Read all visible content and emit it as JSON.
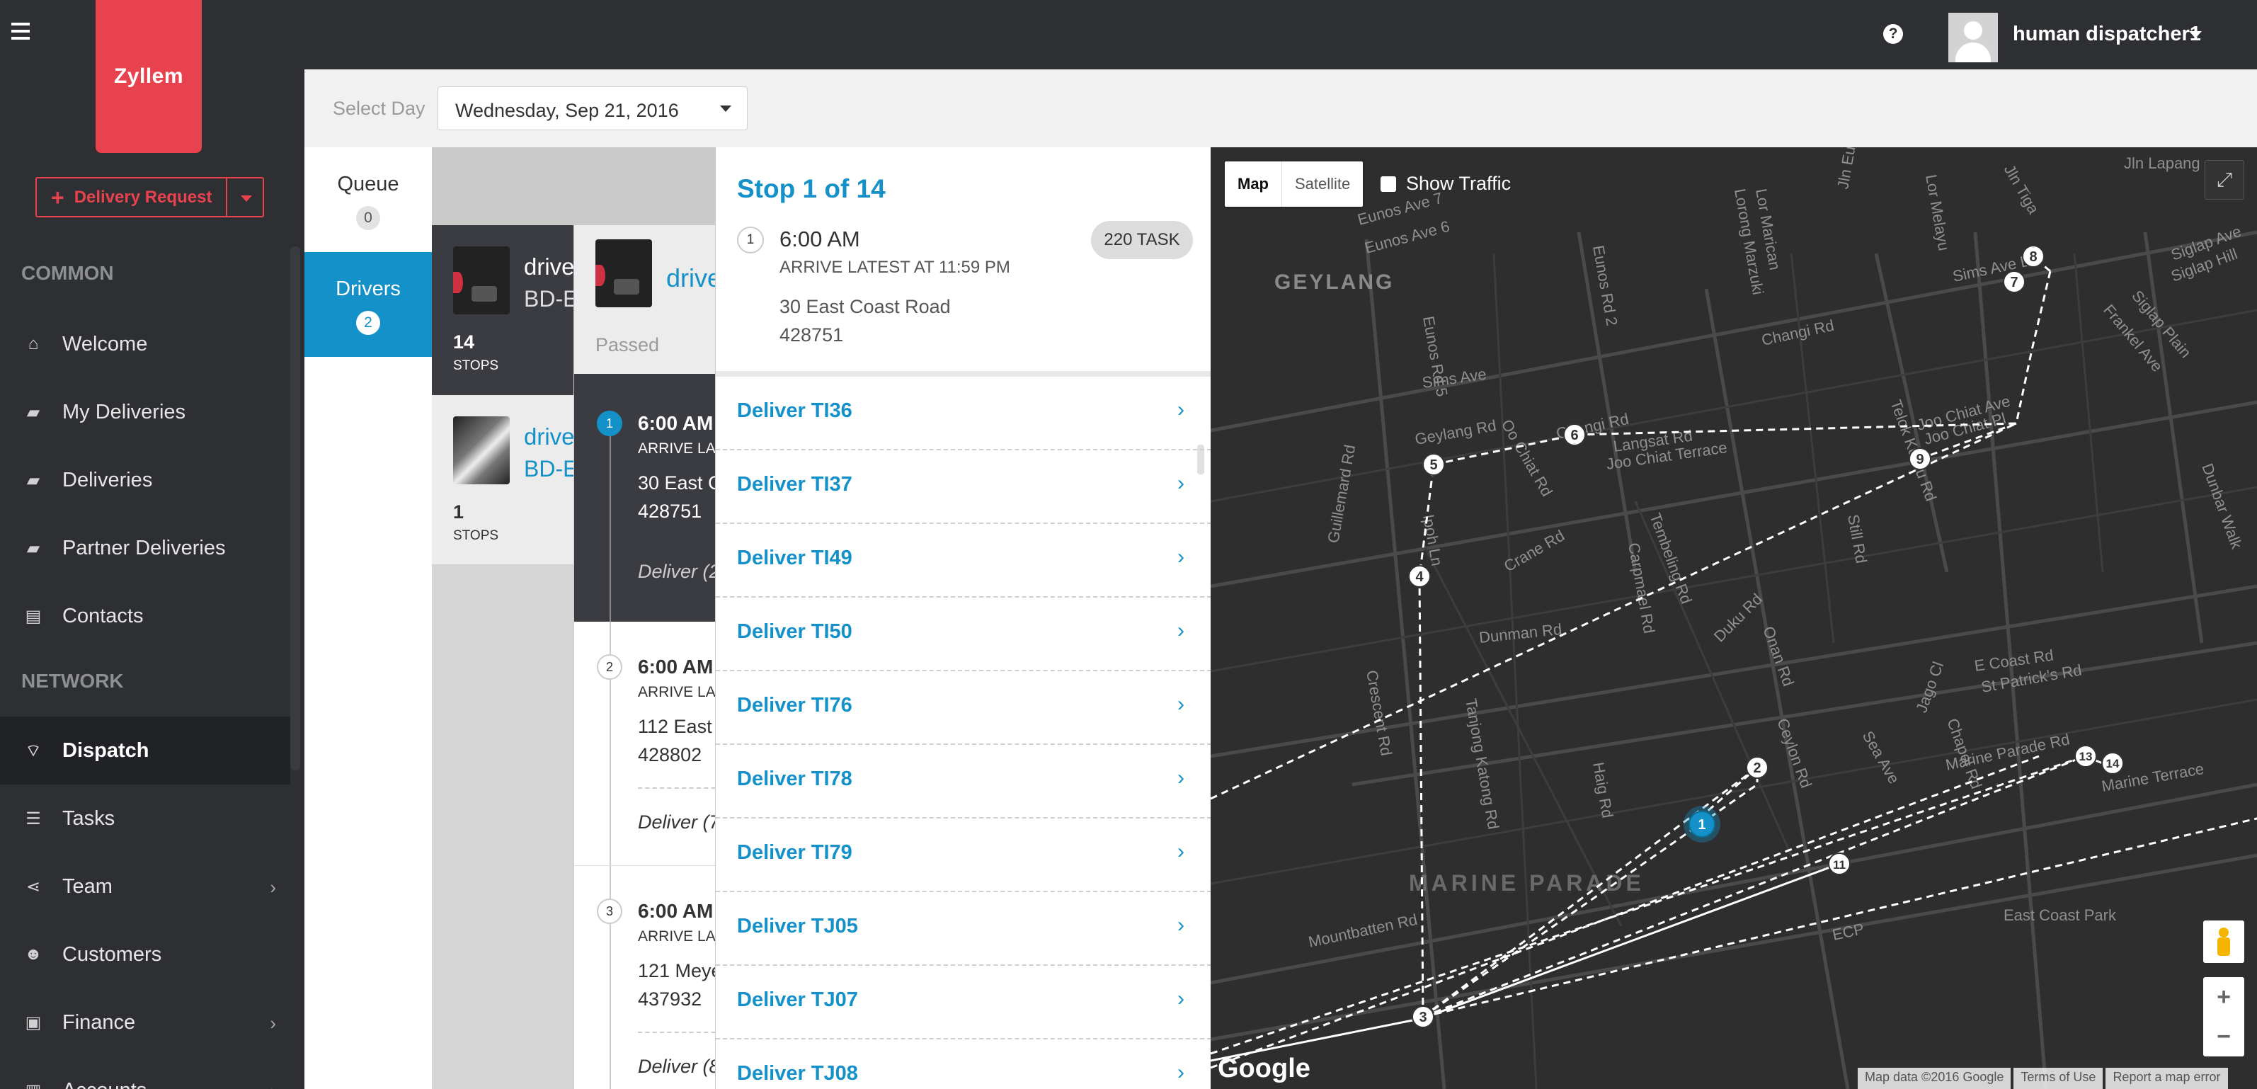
{
  "app": {
    "brand": "Zyllem"
  },
  "header": {
    "user_name": "human dispatcher1",
    "help_icon": "question-circle-icon",
    "menu_icon": "hamburger-icon"
  },
  "sidebar": {
    "delivery_request_label": "Delivery Request",
    "sections": {
      "common": "COMMON",
      "network": "NETWORK"
    },
    "items": [
      {
        "label": "Welcome",
        "icon": "home-icon"
      },
      {
        "label": "My Deliveries",
        "icon": "truck-icon"
      },
      {
        "label": "Deliveries",
        "icon": "truck-icon"
      },
      {
        "label": "Partner Deliveries",
        "icon": "truck-icon"
      },
      {
        "label": "Contacts",
        "icon": "book-icon"
      },
      {
        "label": "Dispatch",
        "icon": "wifi-icon",
        "active": true
      },
      {
        "label": "Tasks",
        "icon": "list-icon"
      },
      {
        "label": "Team",
        "icon": "share-icon"
      },
      {
        "label": "Customers",
        "icon": "users-icon"
      },
      {
        "label": "Finance",
        "icon": "money-icon"
      },
      {
        "label": "Accounts",
        "icon": "account-icon"
      }
    ]
  },
  "daybar": {
    "label": "Select Day",
    "selected_day": "Wednesday, Sep 21, 2016"
  },
  "queue": {
    "queue_label": "Queue",
    "queue_count": "0",
    "drivers_label": "Drivers",
    "drivers_count": "2"
  },
  "drivers": [
    {
      "name": "drive",
      "plate": "BD-E",
      "stops": "14",
      "stops_label": "STOPS"
    },
    {
      "name": "drive",
      "plate": "BD-E",
      "stops": "1",
      "stops_label": "STOPS"
    }
  ],
  "timeline": {
    "driver_name": "drive",
    "passed_label": "Passed",
    "stops": [
      {
        "num": "1",
        "time": "6:00 AM",
        "arrive": "ARRIVE LA",
        "addr1": "30 East C",
        "addr2": "428751",
        "deliver": "Deliver (2"
      },
      {
        "num": "2",
        "time": "6:00 AM",
        "arrive": "ARRIVE LA",
        "addr1": "112 East",
        "addr2": "428802",
        "deliver": "Deliver (7"
      },
      {
        "num": "3",
        "time": "6:00 AM",
        "arrive": "ARRIVE LA",
        "addr1": "121 Meye",
        "addr2": "437932",
        "deliver": "Deliver (8"
      }
    ]
  },
  "panel": {
    "title": "Stop 1 of 14",
    "stop_num": "1",
    "time": "6:00 AM",
    "arrive": "ARRIVE LATEST AT 11:59 PM",
    "addr1": "30 East Coast Road",
    "addr2": "428751",
    "badge": "220 TASK",
    "tasks": [
      "Deliver TI36",
      "Deliver TI37",
      "Deliver TI49",
      "Deliver TI50",
      "Deliver TI76",
      "Deliver TI78",
      "Deliver TI79",
      "Deliver TJ05",
      "Deliver TJ07",
      "Deliver TJ08"
    ]
  },
  "map": {
    "type_map": "Map",
    "type_satellite": "Satellite",
    "show_traffic": "Show Traffic",
    "google": "Google",
    "attribution": [
      "Map data ©2016 Google",
      "Terms of Use",
      "Report a map error"
    ],
    "area_labels": [
      "GEYLANG",
      "MARINE PARADE"
    ],
    "street_labels": [
      "Sims Ave",
      "Geylang Rd",
      "Changi Rd",
      "Guillemard Rd",
      "Joo Chiat Terrace",
      "Langsat Rd",
      "Dunman Rd",
      "Crane Rd",
      "Tembeling Rd",
      "Duku Rd",
      "E Coast Rd",
      "Marine Parade Rd",
      "Marine Terrace",
      "ECP",
      "East Coast Park",
      "Mountbatten Rd",
      "Tanjong Katong Rd",
      "Still Rd",
      "Haig Rd",
      "Eunos Ave 7",
      "Eunos Ave 6",
      "Eunos Rd 2",
      "Eunos Rd 5",
      "Lorong Marzuki",
      "Lor Marican",
      "Jln Eunos",
      "Lor Melayu",
      "Jln Lapang",
      "Jln Tiga",
      "Sims Ave E",
      "Changi Rd",
      "Siglap Hill",
      "Siglap Ave",
      "Siglap Plain",
      "Frankel Ave",
      "Dunbar Walk",
      "Telok Kurau Rd",
      "Joo Chiat Ave",
      "Joo Chiat Pl",
      "Ipoh Ln",
      "Onan Rd",
      "Ceylon Rd",
      "Carpmael Rd",
      "St Patrick's Rd",
      "Sea Ave",
      "Jago Cl",
      "Chapel Rd",
      "Crescent Rd",
      "Oo Chiat Rd"
    ],
    "markers": [
      "1",
      "2",
      "3",
      "4",
      "5",
      "6",
      "7",
      "8",
      "9",
      "11",
      "13",
      "14"
    ],
    "route_color": "#ffffff",
    "current_marker_color": "#1391c8"
  },
  "colors": {
    "brand": "#e8424e",
    "accent": "#1391c8",
    "dark": "#2e2f33"
  }
}
